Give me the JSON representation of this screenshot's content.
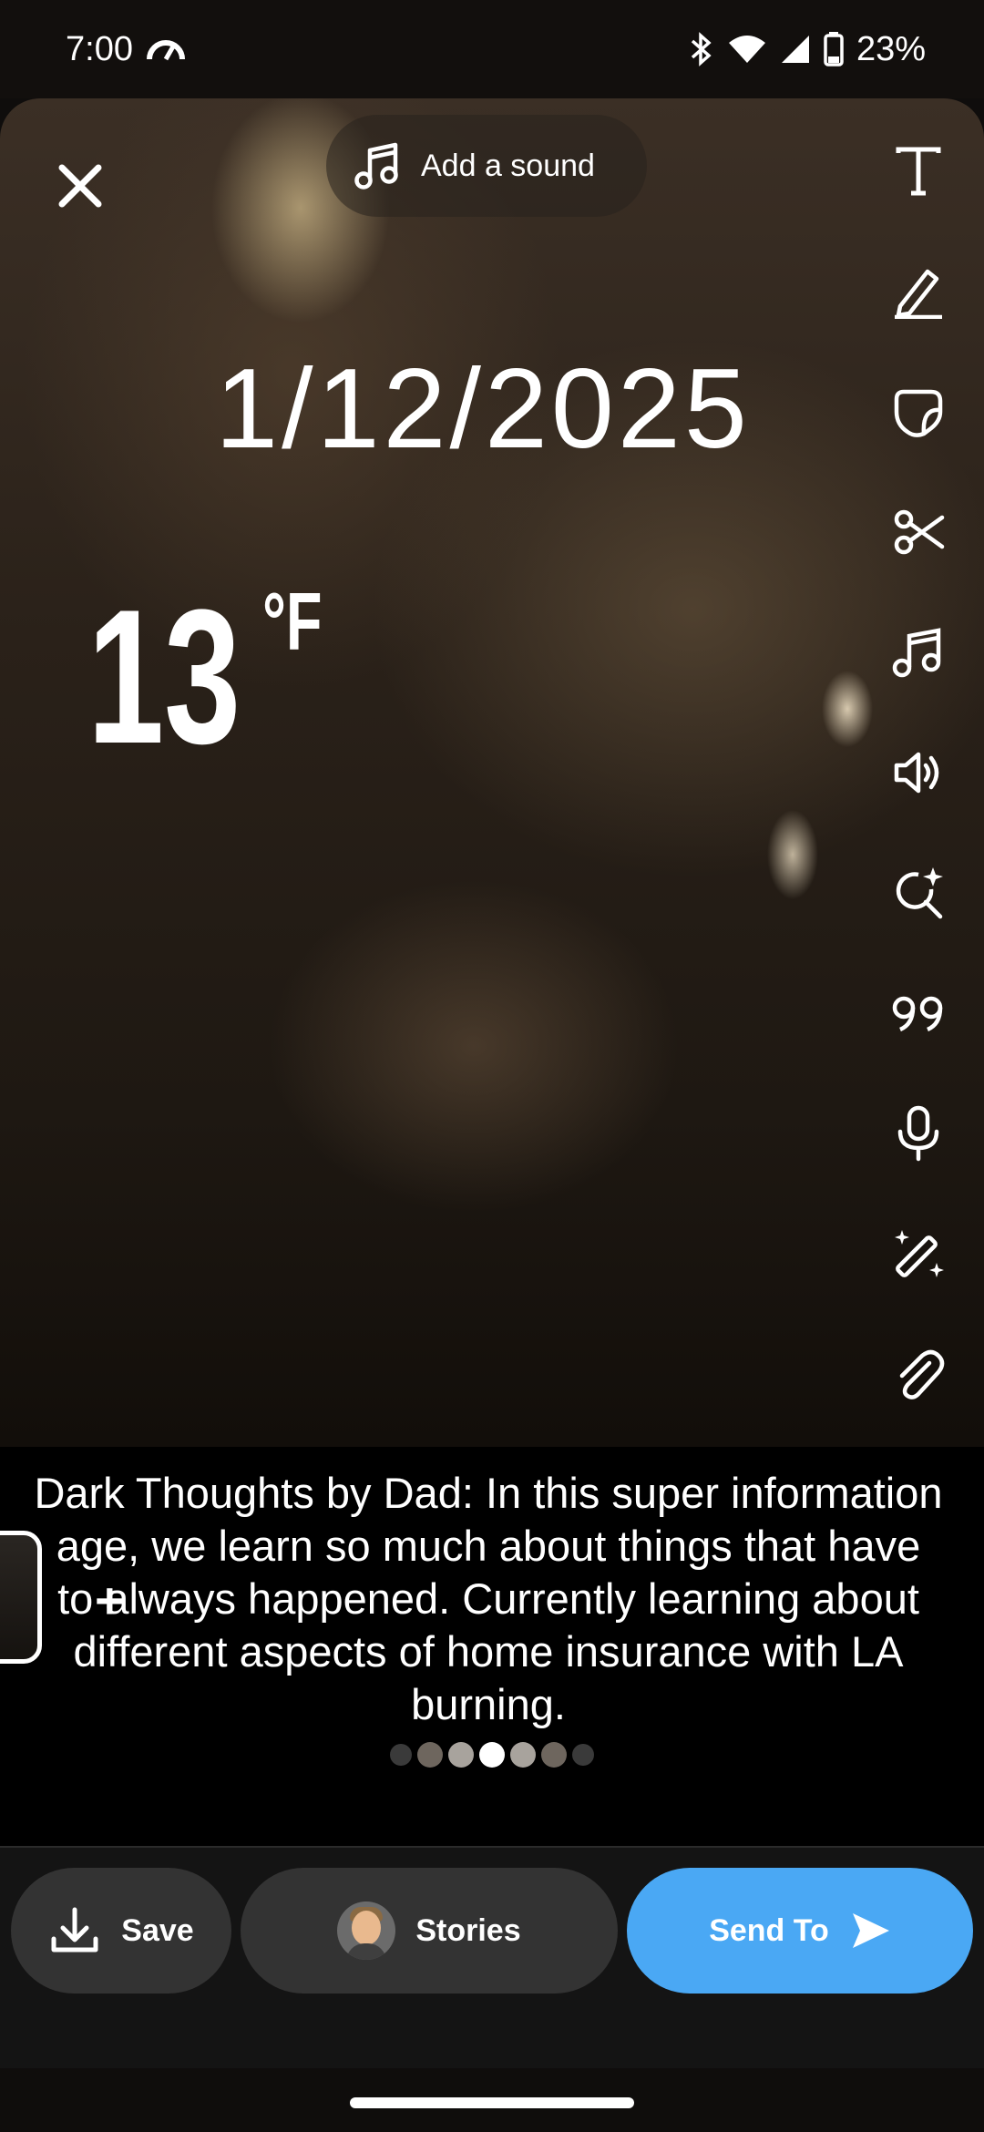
{
  "status_bar": {
    "time": "7:00",
    "battery": "23%",
    "icons": [
      "speedometer-icon",
      "bluetooth-icon",
      "wifi-icon",
      "cell-signal-icon",
      "battery-icon"
    ]
  },
  "editor": {
    "add_sound_label": "Add a sound",
    "date_sticker": "1/12/2025",
    "temperature": {
      "value": "13",
      "unit": "°F"
    },
    "toolbar": [
      "text-tool-icon",
      "pencil-icon",
      "sticker-icon",
      "scissors-icon",
      "music-icon",
      "volume-icon",
      "lens-search-icon",
      "quote-icon",
      "microphone-icon",
      "magic-wand-icon",
      "paperclip-icon",
      "crop-icon",
      "loop-icon"
    ]
  },
  "caption": {
    "text": "Dark Thoughts by Dad: In this super information age, we learn so much about things that have to always happened. Currently learning about different aspects of home insurance with LA burning."
  },
  "page_dots": {
    "count": 7,
    "active_index": 3
  },
  "actions": {
    "save_label": "Save",
    "stories_label": "Stories",
    "send_label": "Send To"
  },
  "colors": {
    "send_button": "#4aa8f4",
    "button_gray": "#333333"
  }
}
